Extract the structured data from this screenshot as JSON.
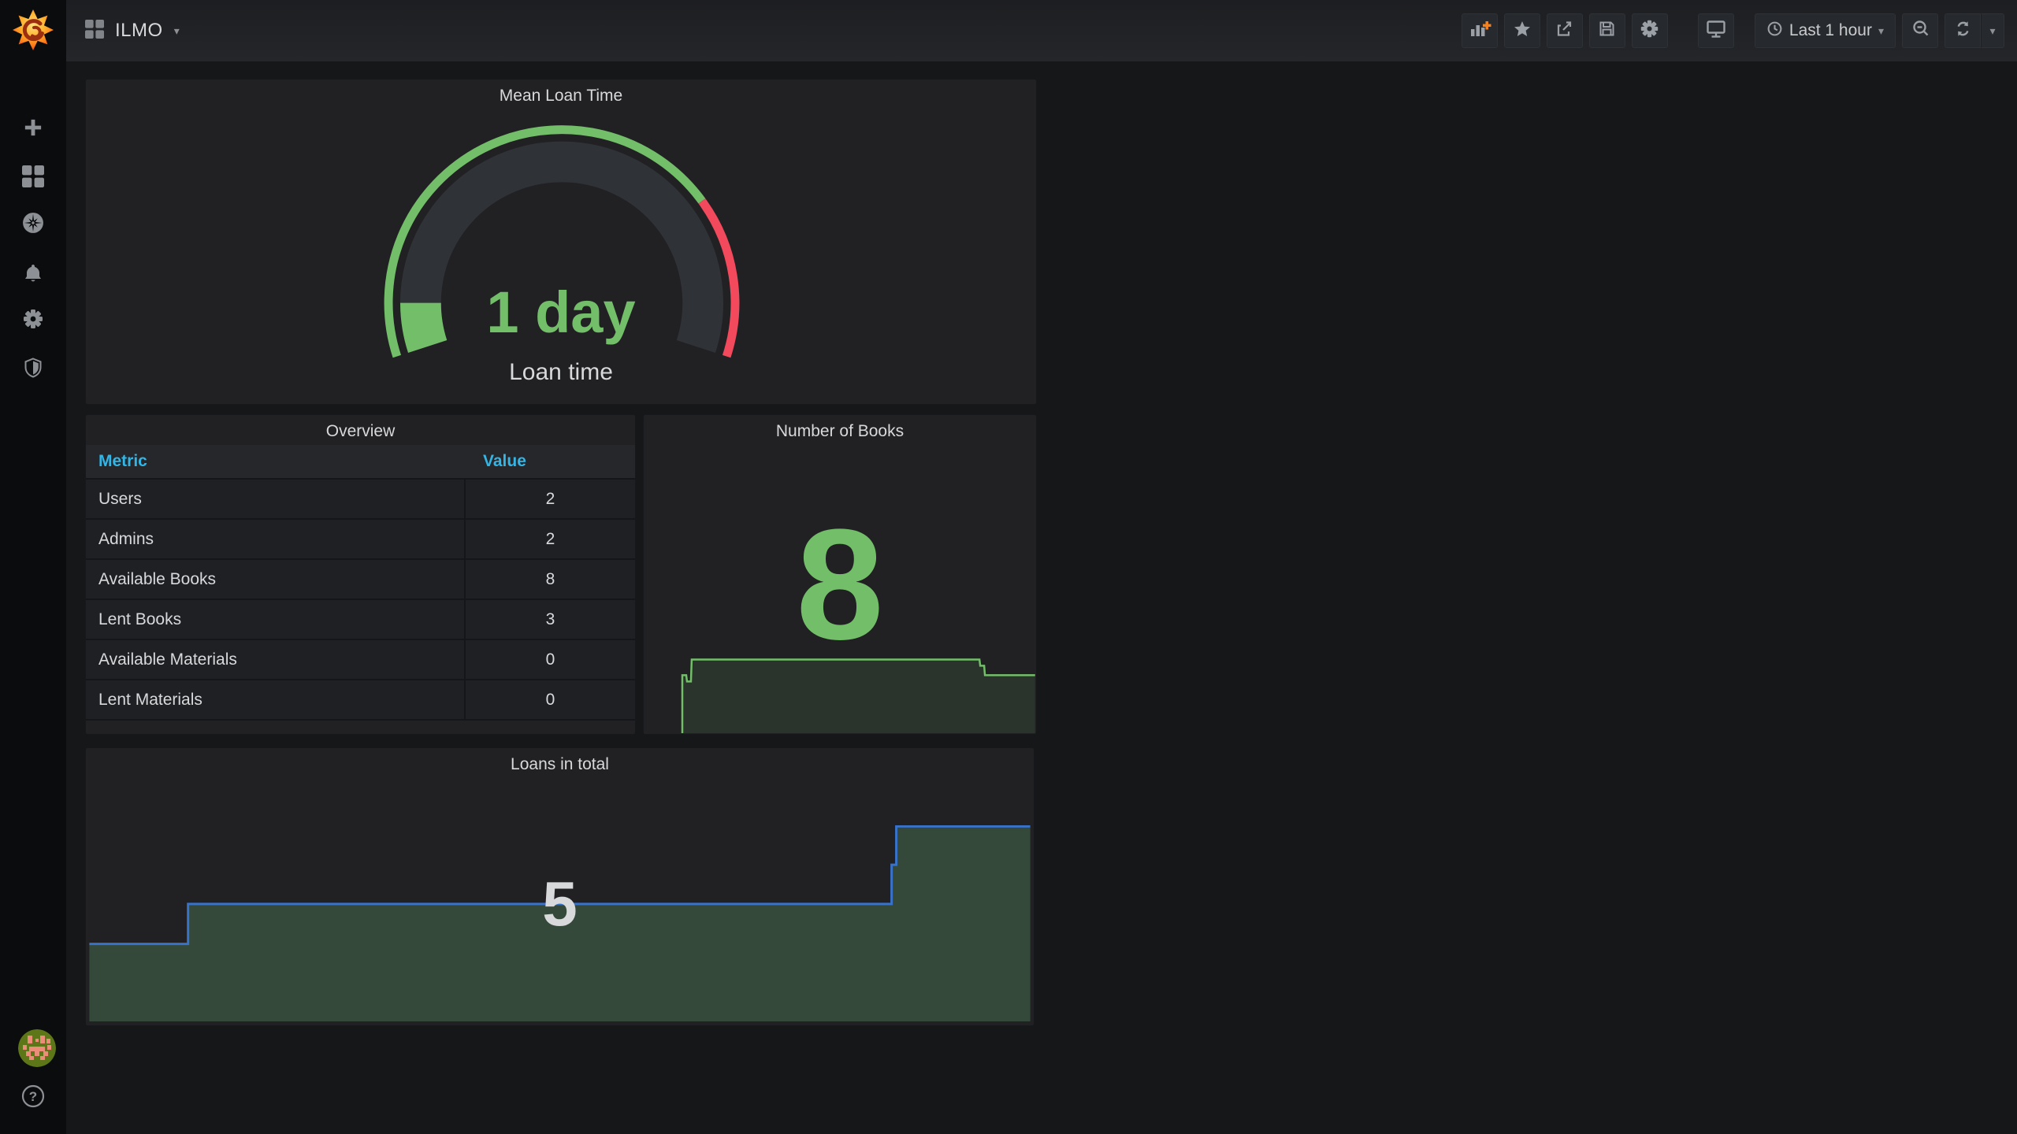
{
  "navbar": {
    "title": "ILMO",
    "time_range": "Last 1 hour",
    "buttons": {
      "add_panel": "add-panel",
      "star": "mark-as-favorite",
      "share": "share-dashboard",
      "save": "save-dashboard",
      "settings": "dashboard-settings",
      "tv_mode": "cycle-view-mode",
      "zoom_out": "zoom-out-time-range",
      "refresh": "refresh-dashboard",
      "refresh_caret": "refresh-interval-picker"
    },
    "refresh_glyph": "⟳",
    "caret_glyph": "▾"
  },
  "sidebar": {
    "items": [
      {
        "name": "create",
        "icon": "plus-icon"
      },
      {
        "name": "dashboards",
        "icon": "grid-icon"
      },
      {
        "name": "explore",
        "icon": "compass-icon"
      },
      {
        "name": "alerting",
        "icon": "bell-icon"
      },
      {
        "name": "configuration",
        "icon": "gear-icon"
      },
      {
        "name": "server-admin",
        "icon": "shield-icon"
      }
    ],
    "help_glyph": "?"
  },
  "panels": {
    "gauge": {
      "title": "Mean Loan Time",
      "value": "1 day",
      "label": "Loan time"
    },
    "overview": {
      "title": "Overview",
      "columns": [
        "Metric",
        "Value"
      ],
      "rows": [
        [
          "Users",
          "2"
        ],
        [
          "Admins",
          "2"
        ],
        [
          "Available Books",
          "8"
        ],
        [
          "Lent Books",
          "3"
        ],
        [
          "Available Materials",
          "0"
        ],
        [
          "Lent Materials",
          "0"
        ]
      ]
    },
    "books": {
      "title": "Number of Books",
      "value": "8"
    },
    "loans": {
      "title": "Loans in total",
      "value": "5"
    }
  },
  "colors": {
    "green": "#73bf69",
    "red": "#f2495c",
    "blue_line": "#3872c9",
    "loans_fill": "#35493a",
    "table_header_blue": "#33b5e5",
    "panel_bg": "#212124",
    "page_bg": "#161719"
  },
  "chart_data": [
    {
      "type": "gauge",
      "title": "Mean Loan Time",
      "display": "1 day",
      "value": 1,
      "unit": "day",
      "label": "Loan time",
      "fill_fraction": 0.08,
      "threshold_green_fraction": 0.75,
      "threshold_red_fraction": 0.25,
      "value_color": "#73bf69",
      "threshold_colors": [
        "#73bf69",
        "#f2495c"
      ]
    },
    {
      "type": "area",
      "title": "Number of Books",
      "current": 8,
      "approx_series": [
        7,
        6,
        8,
        8,
        8,
        8,
        8,
        8,
        8,
        7
      ],
      "line_color": "#73bf69",
      "note": "sparkline: short dip at start, long plateau at 8, small step down to ~7 at right edge"
    },
    {
      "type": "area",
      "title": "Loans in total",
      "current": 5,
      "approx_series": [
        4,
        4,
        5,
        5,
        5,
        5,
        5,
        5,
        5,
        6,
        7,
        7
      ],
      "line_color": "#3872c9",
      "fill_color": "#35493a",
      "note": "step chart: low plateau left, long plateau at 5, step up near right edge"
    },
    {
      "type": "table",
      "title": "Overview",
      "columns": [
        "Metric",
        "Value"
      ],
      "rows": [
        [
          "Users",
          2
        ],
        [
          "Admins",
          2
        ],
        [
          "Available Books",
          8
        ],
        [
          "Lent Books",
          3
        ],
        [
          "Available Materials",
          0
        ],
        [
          "Lent Materials",
          0
        ]
      ]
    }
  ]
}
